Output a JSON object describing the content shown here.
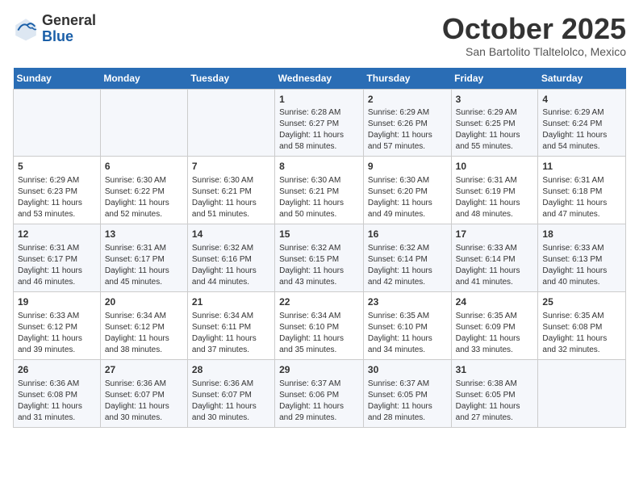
{
  "logo": {
    "general": "General",
    "blue": "Blue"
  },
  "header": {
    "month": "October 2025",
    "location": "San Bartolito Tlaltelolco, Mexico"
  },
  "weekdays": [
    "Sunday",
    "Monday",
    "Tuesday",
    "Wednesday",
    "Thursday",
    "Friday",
    "Saturday"
  ],
  "weeks": [
    [
      {
        "day": "",
        "info": ""
      },
      {
        "day": "",
        "info": ""
      },
      {
        "day": "",
        "info": ""
      },
      {
        "day": "1",
        "info": "Sunrise: 6:28 AM\nSunset: 6:27 PM\nDaylight: 11 hours\nand 58 minutes."
      },
      {
        "day": "2",
        "info": "Sunrise: 6:29 AM\nSunset: 6:26 PM\nDaylight: 11 hours\nand 57 minutes."
      },
      {
        "day": "3",
        "info": "Sunrise: 6:29 AM\nSunset: 6:25 PM\nDaylight: 11 hours\nand 55 minutes."
      },
      {
        "day": "4",
        "info": "Sunrise: 6:29 AM\nSunset: 6:24 PM\nDaylight: 11 hours\nand 54 minutes."
      }
    ],
    [
      {
        "day": "5",
        "info": "Sunrise: 6:29 AM\nSunset: 6:23 PM\nDaylight: 11 hours\nand 53 minutes."
      },
      {
        "day": "6",
        "info": "Sunrise: 6:30 AM\nSunset: 6:22 PM\nDaylight: 11 hours\nand 52 minutes."
      },
      {
        "day": "7",
        "info": "Sunrise: 6:30 AM\nSunset: 6:21 PM\nDaylight: 11 hours\nand 51 minutes."
      },
      {
        "day": "8",
        "info": "Sunrise: 6:30 AM\nSunset: 6:21 PM\nDaylight: 11 hours\nand 50 minutes."
      },
      {
        "day": "9",
        "info": "Sunrise: 6:30 AM\nSunset: 6:20 PM\nDaylight: 11 hours\nand 49 minutes."
      },
      {
        "day": "10",
        "info": "Sunrise: 6:31 AM\nSunset: 6:19 PM\nDaylight: 11 hours\nand 48 minutes."
      },
      {
        "day": "11",
        "info": "Sunrise: 6:31 AM\nSunset: 6:18 PM\nDaylight: 11 hours\nand 47 minutes."
      }
    ],
    [
      {
        "day": "12",
        "info": "Sunrise: 6:31 AM\nSunset: 6:17 PM\nDaylight: 11 hours\nand 46 minutes."
      },
      {
        "day": "13",
        "info": "Sunrise: 6:31 AM\nSunset: 6:17 PM\nDaylight: 11 hours\nand 45 minutes."
      },
      {
        "day": "14",
        "info": "Sunrise: 6:32 AM\nSunset: 6:16 PM\nDaylight: 11 hours\nand 44 minutes."
      },
      {
        "day": "15",
        "info": "Sunrise: 6:32 AM\nSunset: 6:15 PM\nDaylight: 11 hours\nand 43 minutes."
      },
      {
        "day": "16",
        "info": "Sunrise: 6:32 AM\nSunset: 6:14 PM\nDaylight: 11 hours\nand 42 minutes."
      },
      {
        "day": "17",
        "info": "Sunrise: 6:33 AM\nSunset: 6:14 PM\nDaylight: 11 hours\nand 41 minutes."
      },
      {
        "day": "18",
        "info": "Sunrise: 6:33 AM\nSunset: 6:13 PM\nDaylight: 11 hours\nand 40 minutes."
      }
    ],
    [
      {
        "day": "19",
        "info": "Sunrise: 6:33 AM\nSunset: 6:12 PM\nDaylight: 11 hours\nand 39 minutes."
      },
      {
        "day": "20",
        "info": "Sunrise: 6:34 AM\nSunset: 6:12 PM\nDaylight: 11 hours\nand 38 minutes."
      },
      {
        "day": "21",
        "info": "Sunrise: 6:34 AM\nSunset: 6:11 PM\nDaylight: 11 hours\nand 37 minutes."
      },
      {
        "day": "22",
        "info": "Sunrise: 6:34 AM\nSunset: 6:10 PM\nDaylight: 11 hours\nand 35 minutes."
      },
      {
        "day": "23",
        "info": "Sunrise: 6:35 AM\nSunset: 6:10 PM\nDaylight: 11 hours\nand 34 minutes."
      },
      {
        "day": "24",
        "info": "Sunrise: 6:35 AM\nSunset: 6:09 PM\nDaylight: 11 hours\nand 33 minutes."
      },
      {
        "day": "25",
        "info": "Sunrise: 6:35 AM\nSunset: 6:08 PM\nDaylight: 11 hours\nand 32 minutes."
      }
    ],
    [
      {
        "day": "26",
        "info": "Sunrise: 6:36 AM\nSunset: 6:08 PM\nDaylight: 11 hours\nand 31 minutes."
      },
      {
        "day": "27",
        "info": "Sunrise: 6:36 AM\nSunset: 6:07 PM\nDaylight: 11 hours\nand 30 minutes."
      },
      {
        "day": "28",
        "info": "Sunrise: 6:36 AM\nSunset: 6:07 PM\nDaylight: 11 hours\nand 30 minutes."
      },
      {
        "day": "29",
        "info": "Sunrise: 6:37 AM\nSunset: 6:06 PM\nDaylight: 11 hours\nand 29 minutes."
      },
      {
        "day": "30",
        "info": "Sunrise: 6:37 AM\nSunset: 6:05 PM\nDaylight: 11 hours\nand 28 minutes."
      },
      {
        "day": "31",
        "info": "Sunrise: 6:38 AM\nSunset: 6:05 PM\nDaylight: 11 hours\nand 27 minutes."
      },
      {
        "day": "",
        "info": ""
      }
    ]
  ]
}
